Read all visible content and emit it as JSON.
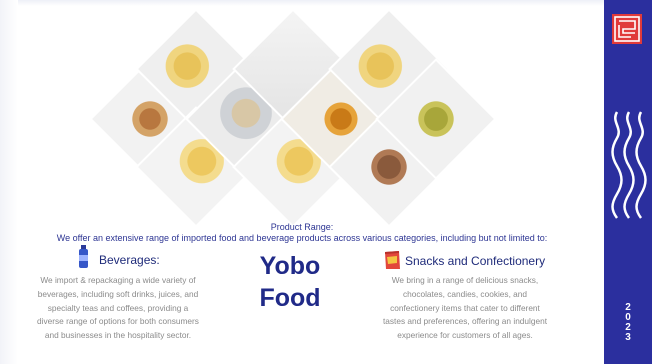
{
  "header": {
    "range_title": "Product Range:",
    "range_subtitle": "We offer an extensive range of imported food and beverage products across various categories, including but not limited to:"
  },
  "beverages": {
    "icon": "bottle-icon",
    "heading": "Beverages:",
    "lines": [
      "We import & repackaging a wide variety of",
      "beverages, including soft drinks, juices, and",
      "specialty teas and coffees, providing a",
      "diverse range of options for both consumers",
      "and businesses in the hospitality sector."
    ]
  },
  "brand": {
    "line1": "Yobo",
    "line2": "Food"
  },
  "snacks": {
    "icon": "chips-bag-icon",
    "heading": "Snacks and Confectionery",
    "lines": [
      "We bring in a range of delicious snacks,",
      "chocolates, candies, cookies, and",
      "confectionery items that cater to different",
      "tastes and preferences, offering an indulgent",
      "experience for customers of all ages."
    ]
  },
  "sidebar": {
    "logo_icon": "maze-logo-icon",
    "year_digits": [
      "2",
      "0",
      "2",
      "3"
    ]
  },
  "colors": {
    "accent": "#2b2f9e",
    "heading": "#1f2b7a",
    "body_text": "#8b8b8b",
    "logo_red": "#e03a3a"
  }
}
